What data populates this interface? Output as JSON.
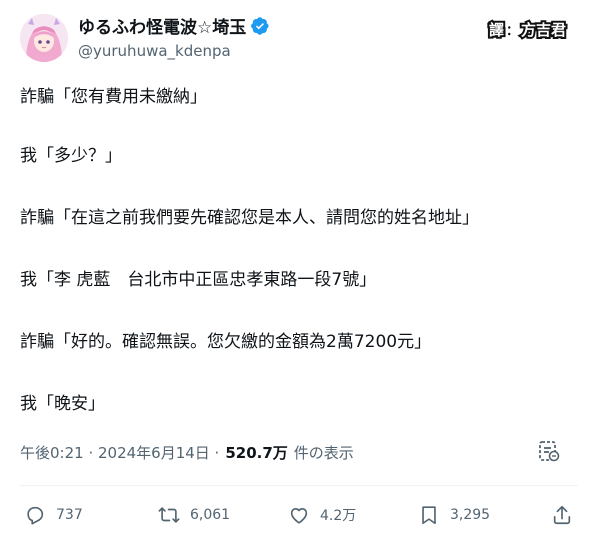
{
  "author": {
    "display_name": "ゆるふわ怪電波☆埼玉",
    "handle": "@yuruhuwa_kdenpa",
    "verified": true,
    "avatar": "avatar-illustration"
  },
  "watermark": {
    "left": "譯",
    "sep": "：",
    "right": "方吉君"
  },
  "tweet": {
    "lines": [
      "詐騙「您有費用未繳納」",
      "我「多少？」",
      "詐騙「在這之前我們要先確認您是本人、請問您的姓名地址」",
      "我「李 虎藍　台北市中正區忠孝東路一段7號」",
      "詐騙「好的。確認無誤。您欠繳的金額為2萬7200元」",
      "我「晚安」"
    ]
  },
  "meta": {
    "timestamp": "午後0:21 · 2024年6月14日 ·",
    "views": "520.7万",
    "views_label": "件の表示"
  },
  "actions": {
    "replies": "737",
    "reposts": "6,061",
    "likes": "4.2万",
    "bookmarks": "3,295"
  },
  "colors": {
    "text": "#0f1419",
    "secondary": "#536471",
    "verified": "#1d9bf0",
    "divider": "#eff3f4"
  }
}
